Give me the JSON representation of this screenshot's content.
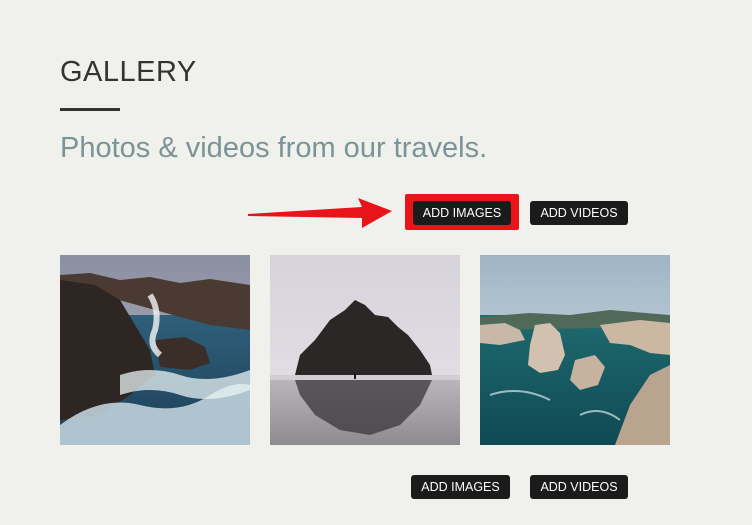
{
  "gallery": {
    "title": "GALLERY",
    "subtitle": "Photos & videos from our travels."
  },
  "buttons_top": {
    "add_images": "ADD IMAGES",
    "add_videos": "ADD VIDEOS"
  },
  "buttons_bottom": {
    "add_images": "ADD IMAGES",
    "add_videos": "ADD VIDEOS"
  },
  "annotation": {
    "arrow_color": "#e8141a",
    "highlight_color": "#e8141a"
  },
  "photos": [
    {
      "subject": "rocky coastline with crashing waves"
    },
    {
      "subject": "sea stack rock reflected on wet beach"
    },
    {
      "subject": "cliffs above turquoise sea"
    }
  ],
  "colors": {
    "background": "#f0f0ec",
    "title": "#333333",
    "subtitle": "#7a9497",
    "button": "#1b1b1b"
  }
}
